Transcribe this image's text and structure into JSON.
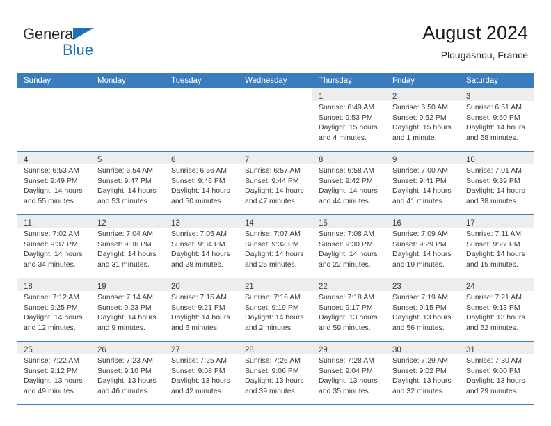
{
  "brand": {
    "name_part1": "General",
    "name_part2": "Blue",
    "accent_color": "#1b72bd"
  },
  "header": {
    "title": "August 2024",
    "subtitle": "Plougasnou, France"
  },
  "theme": {
    "header_row_color": "#3b7cbf",
    "shaded_cell_color": "#ededed",
    "text_color": "#3a3a3a"
  },
  "weekdays": [
    "Sunday",
    "Monday",
    "Tuesday",
    "Wednesday",
    "Thursday",
    "Friday",
    "Saturday"
  ],
  "weeks": [
    [
      {
        "empty": true
      },
      {
        "empty": true
      },
      {
        "empty": true
      },
      {
        "empty": true
      },
      {
        "day": "1",
        "sunrise": "Sunrise: 6:49 AM",
        "sunset": "Sunset: 9:53 PM",
        "daylight1": "Daylight: 15 hours",
        "daylight2": "and 4 minutes."
      },
      {
        "day": "2",
        "sunrise": "Sunrise: 6:50 AM",
        "sunset": "Sunset: 9:52 PM",
        "daylight1": "Daylight: 15 hours",
        "daylight2": "and 1 minute."
      },
      {
        "day": "3",
        "sunrise": "Sunrise: 6:51 AM",
        "sunset": "Sunset: 9:50 PM",
        "daylight1": "Daylight: 14 hours",
        "daylight2": "and 58 minutes."
      }
    ],
    [
      {
        "day": "4",
        "sunrise": "Sunrise: 6:53 AM",
        "sunset": "Sunset: 9:49 PM",
        "daylight1": "Daylight: 14 hours",
        "daylight2": "and 55 minutes."
      },
      {
        "day": "5",
        "sunrise": "Sunrise: 6:54 AM",
        "sunset": "Sunset: 9:47 PM",
        "daylight1": "Daylight: 14 hours",
        "daylight2": "and 53 minutes."
      },
      {
        "day": "6",
        "sunrise": "Sunrise: 6:56 AM",
        "sunset": "Sunset: 9:46 PM",
        "daylight1": "Daylight: 14 hours",
        "daylight2": "and 50 minutes."
      },
      {
        "day": "7",
        "sunrise": "Sunrise: 6:57 AM",
        "sunset": "Sunset: 9:44 PM",
        "daylight1": "Daylight: 14 hours",
        "daylight2": "and 47 minutes."
      },
      {
        "day": "8",
        "sunrise": "Sunrise: 6:58 AM",
        "sunset": "Sunset: 9:42 PM",
        "daylight1": "Daylight: 14 hours",
        "daylight2": "and 44 minutes."
      },
      {
        "day": "9",
        "sunrise": "Sunrise: 7:00 AM",
        "sunset": "Sunset: 9:41 PM",
        "daylight1": "Daylight: 14 hours",
        "daylight2": "and 41 minutes."
      },
      {
        "day": "10",
        "sunrise": "Sunrise: 7:01 AM",
        "sunset": "Sunset: 9:39 PM",
        "daylight1": "Daylight: 14 hours",
        "daylight2": "and 38 minutes."
      }
    ],
    [
      {
        "day": "11",
        "sunrise": "Sunrise: 7:02 AM",
        "sunset": "Sunset: 9:37 PM",
        "daylight1": "Daylight: 14 hours",
        "daylight2": "and 34 minutes."
      },
      {
        "day": "12",
        "sunrise": "Sunrise: 7:04 AM",
        "sunset": "Sunset: 9:36 PM",
        "daylight1": "Daylight: 14 hours",
        "daylight2": "and 31 minutes."
      },
      {
        "day": "13",
        "sunrise": "Sunrise: 7:05 AM",
        "sunset": "Sunset: 9:34 PM",
        "daylight1": "Daylight: 14 hours",
        "daylight2": "and 28 minutes."
      },
      {
        "day": "14",
        "sunrise": "Sunrise: 7:07 AM",
        "sunset": "Sunset: 9:32 PM",
        "daylight1": "Daylight: 14 hours",
        "daylight2": "and 25 minutes."
      },
      {
        "day": "15",
        "sunrise": "Sunrise: 7:08 AM",
        "sunset": "Sunset: 9:30 PM",
        "daylight1": "Daylight: 14 hours",
        "daylight2": "and 22 minutes."
      },
      {
        "day": "16",
        "sunrise": "Sunrise: 7:09 AM",
        "sunset": "Sunset: 9:29 PM",
        "daylight1": "Daylight: 14 hours",
        "daylight2": "and 19 minutes."
      },
      {
        "day": "17",
        "sunrise": "Sunrise: 7:11 AM",
        "sunset": "Sunset: 9:27 PM",
        "daylight1": "Daylight: 14 hours",
        "daylight2": "and 15 minutes."
      }
    ],
    [
      {
        "day": "18",
        "sunrise": "Sunrise: 7:12 AM",
        "sunset": "Sunset: 9:25 PM",
        "daylight1": "Daylight: 14 hours",
        "daylight2": "and 12 minutes."
      },
      {
        "day": "19",
        "sunrise": "Sunrise: 7:14 AM",
        "sunset": "Sunset: 9:23 PM",
        "daylight1": "Daylight: 14 hours",
        "daylight2": "and 9 minutes."
      },
      {
        "day": "20",
        "sunrise": "Sunrise: 7:15 AM",
        "sunset": "Sunset: 9:21 PM",
        "daylight1": "Daylight: 14 hours",
        "daylight2": "and 6 minutes."
      },
      {
        "day": "21",
        "sunrise": "Sunrise: 7:16 AM",
        "sunset": "Sunset: 9:19 PM",
        "daylight1": "Daylight: 14 hours",
        "daylight2": "and 2 minutes."
      },
      {
        "day": "22",
        "sunrise": "Sunrise: 7:18 AM",
        "sunset": "Sunset: 9:17 PM",
        "daylight1": "Daylight: 13 hours",
        "daylight2": "and 59 minutes."
      },
      {
        "day": "23",
        "sunrise": "Sunrise: 7:19 AM",
        "sunset": "Sunset: 9:15 PM",
        "daylight1": "Daylight: 13 hours",
        "daylight2": "and 56 minutes."
      },
      {
        "day": "24",
        "sunrise": "Sunrise: 7:21 AM",
        "sunset": "Sunset: 9:13 PM",
        "daylight1": "Daylight: 13 hours",
        "daylight2": "and 52 minutes."
      }
    ],
    [
      {
        "day": "25",
        "sunrise": "Sunrise: 7:22 AM",
        "sunset": "Sunset: 9:12 PM",
        "daylight1": "Daylight: 13 hours",
        "daylight2": "and 49 minutes."
      },
      {
        "day": "26",
        "sunrise": "Sunrise: 7:23 AM",
        "sunset": "Sunset: 9:10 PM",
        "daylight1": "Daylight: 13 hours",
        "daylight2": "and 46 minutes."
      },
      {
        "day": "27",
        "sunrise": "Sunrise: 7:25 AM",
        "sunset": "Sunset: 9:08 PM",
        "daylight1": "Daylight: 13 hours",
        "daylight2": "and 42 minutes."
      },
      {
        "day": "28",
        "sunrise": "Sunrise: 7:26 AM",
        "sunset": "Sunset: 9:06 PM",
        "daylight1": "Daylight: 13 hours",
        "daylight2": "and 39 minutes."
      },
      {
        "day": "29",
        "sunrise": "Sunrise: 7:28 AM",
        "sunset": "Sunset: 9:04 PM",
        "daylight1": "Daylight: 13 hours",
        "daylight2": "and 35 minutes."
      },
      {
        "day": "30",
        "sunrise": "Sunrise: 7:29 AM",
        "sunset": "Sunset: 9:02 PM",
        "daylight1": "Daylight: 13 hours",
        "daylight2": "and 32 minutes."
      },
      {
        "day": "31",
        "sunrise": "Sunrise: 7:30 AM",
        "sunset": "Sunset: 9:00 PM",
        "daylight1": "Daylight: 13 hours",
        "daylight2": "and 29 minutes."
      }
    ]
  ]
}
